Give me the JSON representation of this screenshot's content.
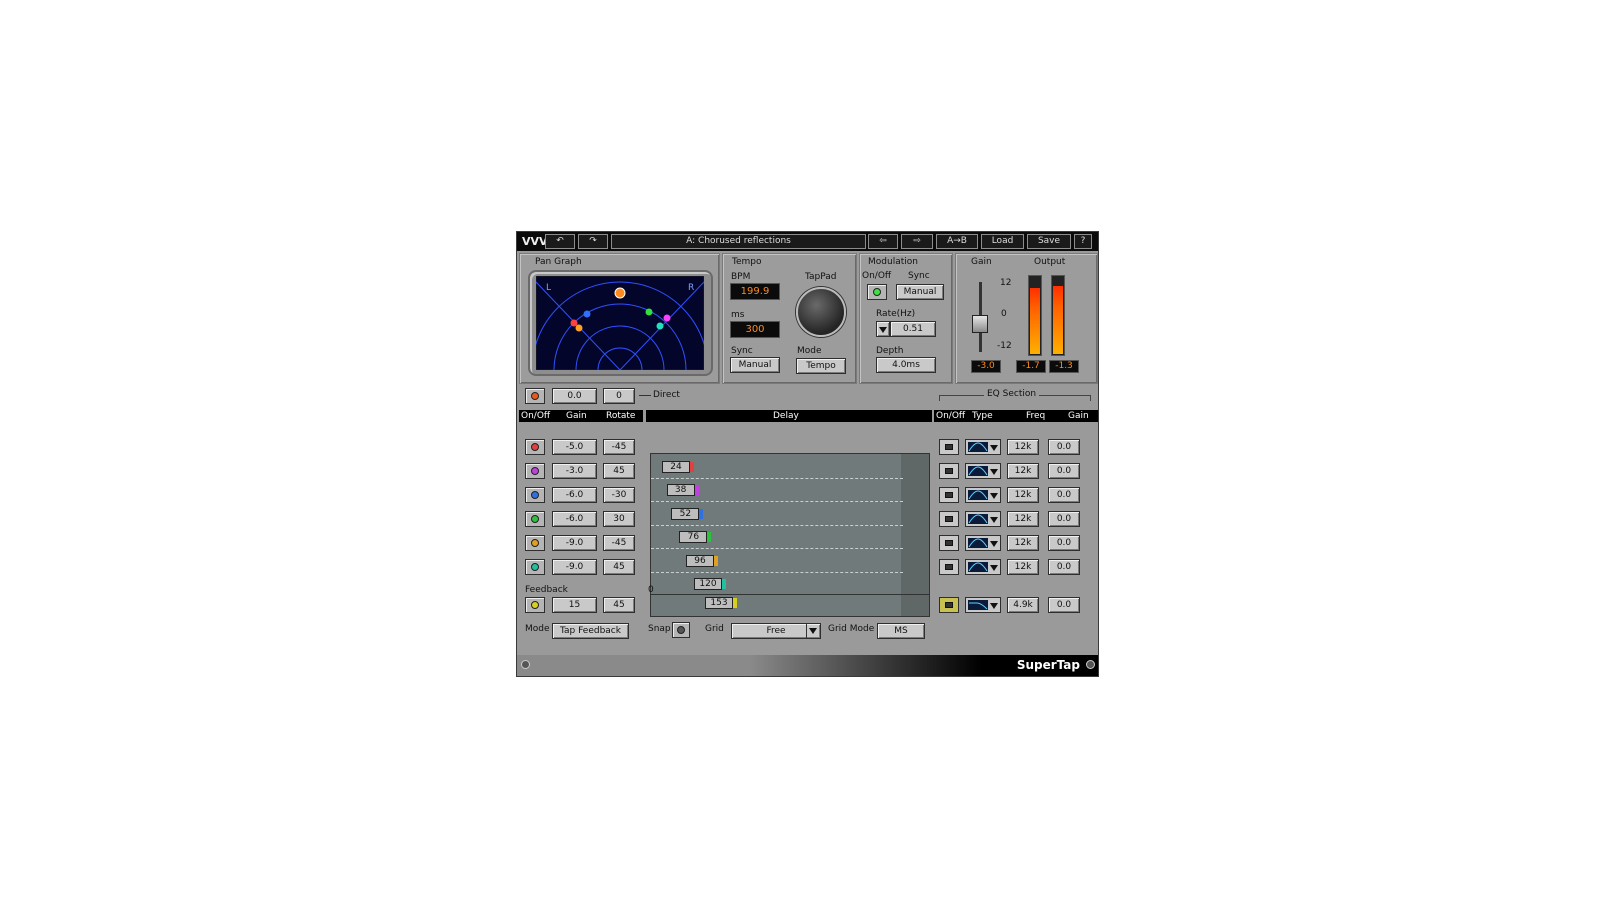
{
  "topbar": {
    "preset_name": "A: Chorused reflections",
    "undo_label": "↶",
    "redo_label": "↷",
    "prev_label": "⇦",
    "next_label": "⇨",
    "ab_label": "A→B",
    "load_label": "Load",
    "save_label": "Save",
    "help_label": "?"
  },
  "pan_graph": {
    "title": "Pan Graph",
    "left_label": "L",
    "right_label": "R"
  },
  "tempo": {
    "title": "Tempo",
    "bpm_label": "BPM",
    "bpm_value": "199.9",
    "ms_label": "ms",
    "ms_value": "300",
    "sync_label": "Sync",
    "sync_value": "Manual",
    "tappad_label": "TapPad",
    "mode_label": "Mode",
    "mode_value": "Tempo"
  },
  "modulation": {
    "title": "Modulation",
    "onoff_label": "On/Off",
    "sync_label": "Sync",
    "sync_value": "Manual",
    "rate_label": "Rate(Hz)",
    "rate_value": "0.51",
    "depth_label": "Depth",
    "depth_value": "4.0ms"
  },
  "output": {
    "gain_label": "Gain",
    "output_label": "Output",
    "scale_top": "12",
    "scale_mid": "0",
    "scale_bottom": "-12",
    "gain_value": "-3.0",
    "out_left": "-1.7",
    "out_right": "-1.3",
    "meter_left_level": 0.85,
    "meter_right_level": 0.87
  },
  "direct": {
    "gain": "0.0",
    "rotate": "0",
    "label": "Direct",
    "led_color": "#e85a1a"
  },
  "headers": {
    "onoff": "On/Off",
    "gain": "Gain",
    "rotate": "Rotate",
    "delay": "Delay",
    "eq_onoff": "On/Off",
    "eq_type": "Type",
    "eq_freq": "Freq",
    "eq_gain": "Gain",
    "eq_section": "EQ Section"
  },
  "taps": [
    {
      "gain": "-5.0",
      "rotate": "-45",
      "delay": "24",
      "color": "#e04040",
      "eq_freq": "12k",
      "eq_gain": "0.0"
    },
    {
      "gain": "-3.0",
      "rotate": "45",
      "delay": "38",
      "color": "#c040e0",
      "eq_freq": "12k",
      "eq_gain": "0.0"
    },
    {
      "gain": "-6.0",
      "rotate": "-30",
      "delay": "52",
      "color": "#3070e0",
      "eq_freq": "12k",
      "eq_gain": "0.0"
    },
    {
      "gain": "-6.0",
      "rotate": "30",
      "delay": "76",
      "color": "#30c040",
      "eq_freq": "12k",
      "eq_gain": "0.0"
    },
    {
      "gain": "-9.0",
      "rotate": "-45",
      "delay": "96",
      "color": "#e0a020",
      "eq_freq": "12k",
      "eq_gain": "0.0"
    },
    {
      "gain": "-9.0",
      "rotate": "45",
      "delay": "120",
      "color": "#20c0a0",
      "eq_freq": "12k",
      "eq_gain": "0.0"
    }
  ],
  "feedback": {
    "label": "Feedback",
    "gain": "15",
    "rotate": "45",
    "delay": "153",
    "zero_label": "0",
    "color": "#d8d020",
    "eq_freq": "4.9k",
    "eq_gain": "0.0"
  },
  "bottom": {
    "mode_label": "Mode",
    "mode_value": "Tap Feedback",
    "snap_label": "Snap",
    "grid_label": "Grid",
    "grid_value": "Free",
    "gridmode_label": "Grid Mode",
    "gridmode_value": "MS"
  },
  "footer": {
    "product_name": "SuperTap"
  }
}
